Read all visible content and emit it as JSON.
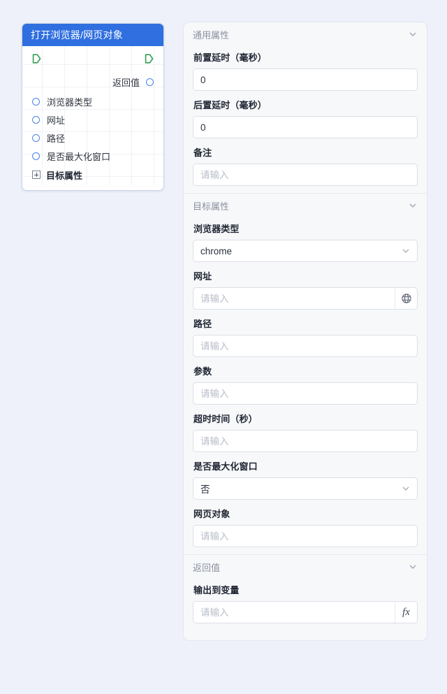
{
  "canvas": {
    "node": {
      "title": "打开浏览器/网页对象",
      "flow_in_icon": "flow-in-port-icon",
      "flow_out_icon": "flow-out-port-icon",
      "return_label": "返回值",
      "input_ports": [
        {
          "label": "浏览器类型"
        },
        {
          "label": "网址"
        },
        {
          "label": "路径"
        },
        {
          "label": "是否最大化窗口"
        }
      ],
      "expand": {
        "label": "目标属性",
        "icon": "plus-square-icon"
      }
    }
  },
  "panel": {
    "sections": [
      {
        "title": "通用属性",
        "collapse_icon": "chevron-down-icon",
        "fields": [
          {
            "label": "前置延时（毫秒）",
            "type": "input",
            "value": "0",
            "placeholder": "请输入"
          },
          {
            "label": "后置延时（毫秒）",
            "type": "input",
            "value": "0",
            "placeholder": "请输入"
          },
          {
            "label": "备注",
            "type": "input",
            "value": "",
            "placeholder": "请输入"
          }
        ]
      },
      {
        "title": "目标属性",
        "collapse_icon": "chevron-down-icon",
        "fields": [
          {
            "label": "浏览器类型",
            "type": "select",
            "value": "chrome",
            "placeholder": ""
          },
          {
            "label": "网址",
            "type": "input-globe",
            "value": "",
            "placeholder": "请输入",
            "addon_icon": "globe-icon"
          },
          {
            "label": "路径",
            "type": "input",
            "value": "",
            "placeholder": "请输入"
          },
          {
            "label": "参数",
            "type": "input",
            "value": "",
            "placeholder": "请输入"
          },
          {
            "label": "超时时间（秒）",
            "type": "input",
            "value": "",
            "placeholder": "请输入"
          },
          {
            "label": "是否最大化窗口",
            "type": "select",
            "value": "否",
            "placeholder": ""
          },
          {
            "label": "网页对象",
            "type": "input",
            "value": "",
            "placeholder": "请输入"
          }
        ]
      },
      {
        "title": "返回值",
        "collapse_icon": "chevron-down-icon",
        "fields": [
          {
            "label": "输出到变量",
            "type": "input-fx",
            "value": "",
            "placeholder": "请输入",
            "addon_icon": "fx-icon",
            "addon_text": "fx"
          }
        ]
      }
    ]
  },
  "colors": {
    "canvas_bg": "#eef1fa",
    "node_header": "#2f6fe0",
    "flow_port": "#2f9e4f",
    "data_port": "#4a84e8",
    "panel_bg": "#f7f8fa"
  }
}
